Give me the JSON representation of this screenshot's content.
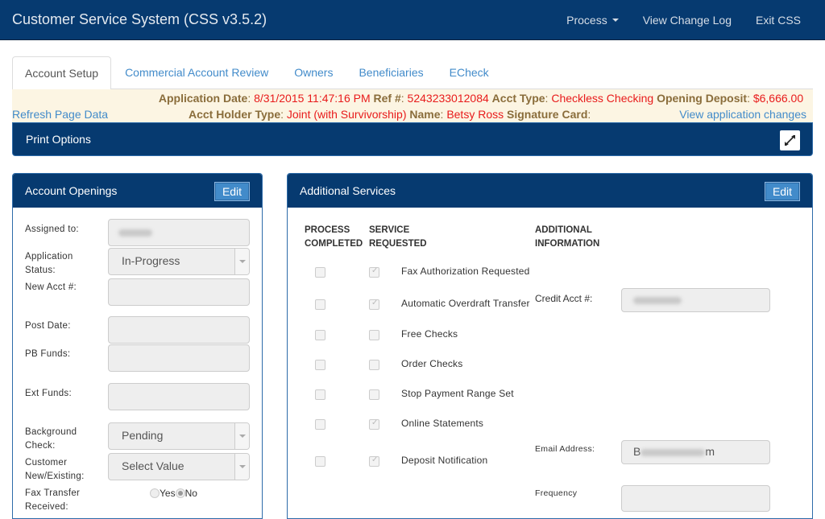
{
  "app": {
    "title": "Customer Service System (CSS v3.5.2)",
    "nav": [
      {
        "label": "Process",
        "has_dropdown": true
      },
      {
        "label": "View Change Log"
      },
      {
        "label": "Exit CSS"
      }
    ]
  },
  "tabs": [
    {
      "label": "Account Setup",
      "active": true
    },
    {
      "label": "Commercial Account Review"
    },
    {
      "label": "Owners"
    },
    {
      "label": "Beneficiaries"
    },
    {
      "label": "ECheck"
    }
  ],
  "info": {
    "application_date_label": "Application Date",
    "application_date": "8/31/2015 11:47:16 PM",
    "ref_label": "Ref #",
    "ref": "5243233012084",
    "acct_type_label": "Acct Type",
    "acct_type": "Checkless Checking",
    "opening_deposit_label": "Opening Deposit",
    "opening_deposit": "$6,666.00",
    "acct_holder_type_label": "Acct Holder Type",
    "acct_holder_type": "Joint (with Survivorship)",
    "name_label": "Name",
    "name": "Betsy Ross",
    "signature_card_label": "Signature Card",
    "signature_card": "",
    "refresh_link": "Refresh Page Data",
    "view_changes_link": "View application changes"
  },
  "print_options": {
    "title": "Print Options",
    "expand_icon": "expand-arrows-icon"
  },
  "account_openings": {
    "title": "Account Openings",
    "edit_label": "Edit",
    "fields": {
      "assigned_to": {
        "label": "Assigned to:",
        "value": "[redacted]"
      },
      "application_status": {
        "label1": "Application",
        "label2": "Status:",
        "value": "In-Progress"
      },
      "new_acct": {
        "label": "New Acct #:",
        "value": ""
      },
      "post_date": {
        "label": "Post Date:",
        "value": ""
      },
      "pb_funds": {
        "label": "PB Funds:",
        "value": ""
      },
      "ext_funds": {
        "label": "Ext Funds:",
        "value": ""
      },
      "background_check": {
        "label1": "Background",
        "label2": "Check:",
        "value": "Pending"
      },
      "customer_new_existing": {
        "label1": "Customer",
        "label2": "New/Existing:",
        "value": "Select Value"
      },
      "fax_transfer": {
        "label1": "Fax Transfer",
        "label2": "Received:",
        "options": [
          "Yes",
          "No"
        ],
        "selected": "No"
      }
    }
  },
  "additional_services": {
    "title": "Additional Services",
    "edit_label": "Edit",
    "headers": {
      "process_completed": [
        "PROCESS",
        "COMPLETED"
      ],
      "service_requested": [
        "SERVICE",
        "REQUESTED"
      ],
      "additional_information": [
        "ADDITIONAL",
        "INFORMATION"
      ]
    },
    "services": [
      {
        "label": "Fax Authorization Requested",
        "completed": false,
        "requested": true
      },
      {
        "label": "Automatic Overdraft Transfer",
        "completed": false,
        "requested": true
      },
      {
        "label": "Free Checks",
        "completed": false,
        "requested": false
      },
      {
        "label": "Order Checks",
        "completed": false,
        "requested": false
      },
      {
        "label": "Stop Payment Range Set",
        "completed": false,
        "requested": false
      },
      {
        "label": "Online Statements",
        "completed": false,
        "requested": true
      },
      {
        "label": "Deposit Notification",
        "completed": false,
        "requested": true
      }
    ],
    "info_fields": {
      "credit_acct": {
        "label": "Credit Acct #:",
        "value": "[redacted]"
      },
      "email_address": {
        "label": "Email Address:",
        "value_start": "B",
        "value_end": "m"
      },
      "frequency": {
        "label": "Frequency",
        "value": ""
      }
    }
  }
}
